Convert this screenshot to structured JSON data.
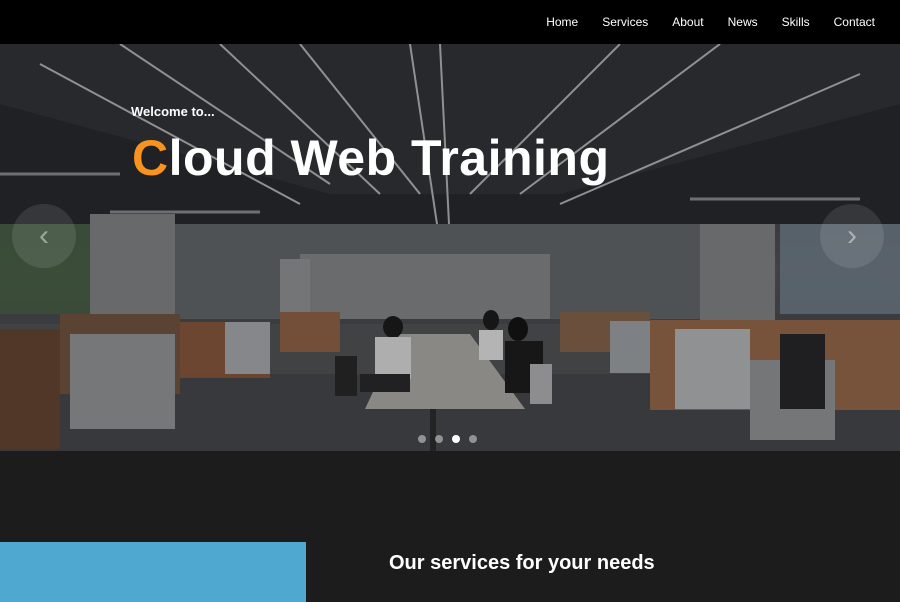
{
  "nav": {
    "items": [
      {
        "label": "Home"
      },
      {
        "label": "Services"
      },
      {
        "label": "About"
      },
      {
        "label": "News"
      },
      {
        "label": "Skills"
      },
      {
        "label": "Contact"
      }
    ]
  },
  "hero": {
    "welcome": "Welcome to...",
    "title_first_letter": "C",
    "title_rest": "loud Web Training",
    "prev_icon": "‹",
    "next_icon": "›",
    "slide_count": 4,
    "active_slide": 3,
    "accent_color": "#f7931e"
  },
  "services": {
    "heading": "Our services for your needs",
    "block_color": "#4ea8cf"
  }
}
